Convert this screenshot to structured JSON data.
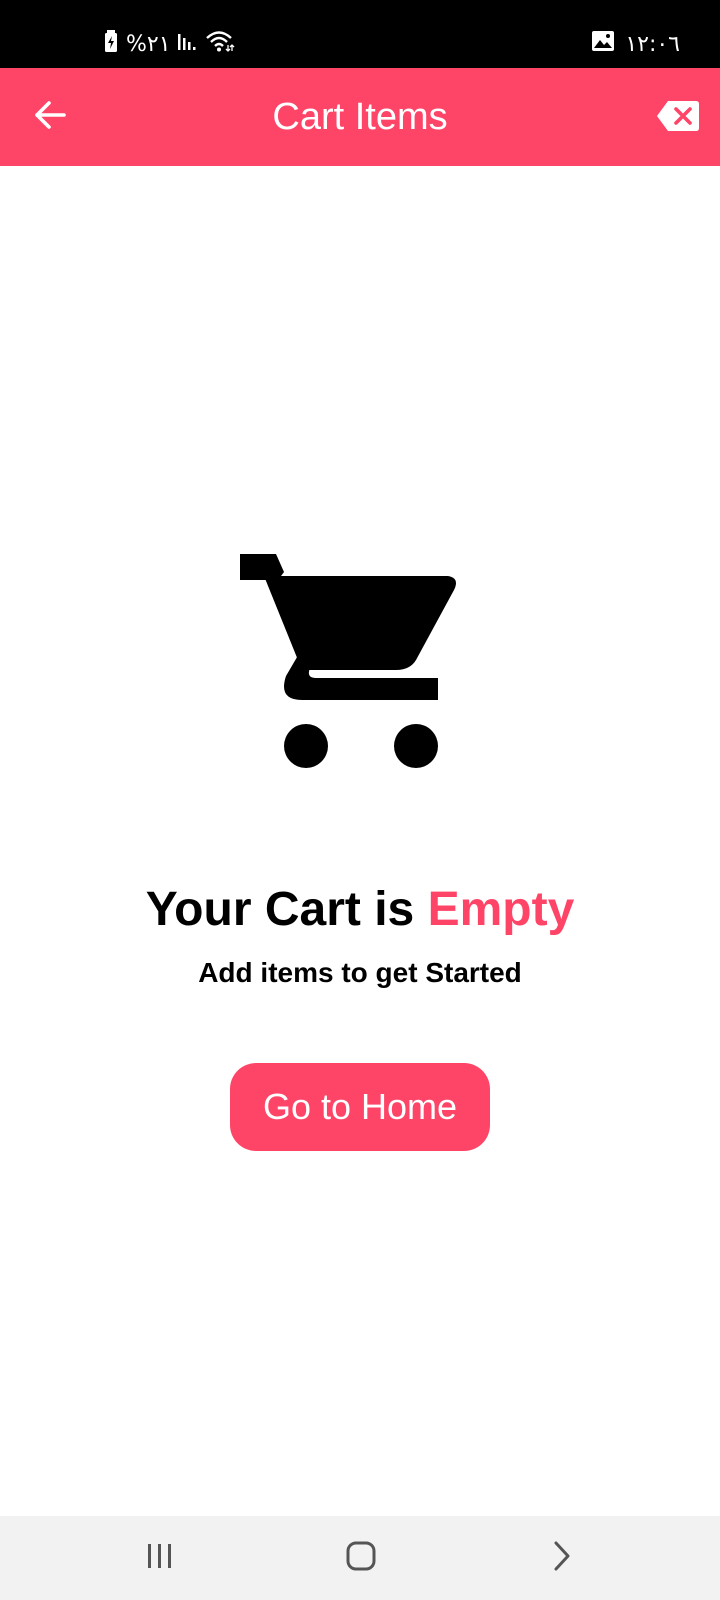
{
  "status_bar": {
    "battery_percent": "%٢١",
    "time": "١٢:٠٦",
    "icons": [
      "battery-charging-icon",
      "signal-icon",
      "wifi-icon",
      "image-notification-icon"
    ]
  },
  "app_bar": {
    "title": "Cart Items",
    "back_icon": "arrow-left-icon",
    "clear_icon": "backspace-clear-icon",
    "color": "#ff4567"
  },
  "empty_state": {
    "icon": "shopping-cart-icon",
    "headline_prefix": "Your Cart is ",
    "headline_accent": "Empty",
    "subline": "Add items to get Started",
    "accent_color": "#ff4567"
  },
  "action": {
    "home_button_label": "Go to Home"
  },
  "nav_bar": {
    "icons": [
      "recents-icon",
      "home-icon",
      "back-chevron-icon"
    ]
  }
}
